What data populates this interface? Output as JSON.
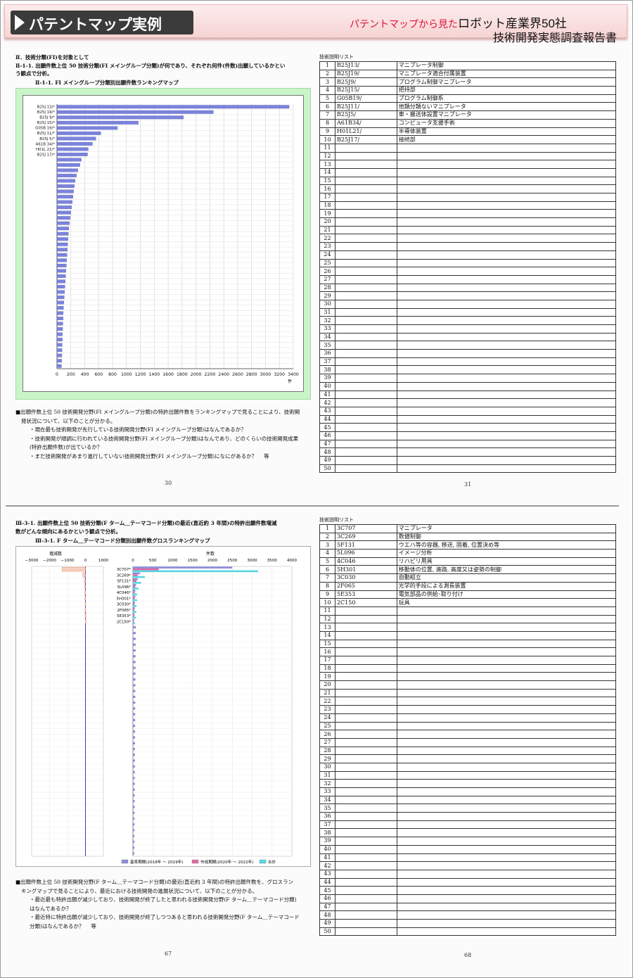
{
  "header": {
    "banner": "パテントマップ実例",
    "sub_red": "パテントマップから見た",
    "sub_main": "ロボット産業界50社",
    "line2": "技術開発実態調査報告書"
  },
  "page30": {
    "heading1": "Ⅱ．技術分類(FI)を対象として",
    "heading2": "Ⅱ-1-1. 出願件数上位 50 技術分類(FI メイングループ分類)が何であり、それぞれ何件(件数)出願しているかとい",
    "heading3": "う観点で分析。",
    "chart_title": "Ⅱ-1-1. FI メイングループ分類別出願件数ランキングマップ",
    "notes": [
      "■出願件数上位 50 技術開発分野(FI メイングループ分類)の特許出願件数をランキングマップで見ることにより、技術開",
      "発状況について、以下のことが分かる。",
      "・現在最も技術開発が先行している技術開発分野(FI メイングループ分類)はなんであるか？",
      "・技術開発が順調に行われている技術開発分野(FI メイングループ分類)はなんであり、どのくらいの技術開発成果",
      "(特許出願件数)が出ているか？",
      "・まだ技術開発があまり進行していない技術開発分野(FI メイングループ分類)になにがあるか？　 等"
    ],
    "page_number": "30"
  },
  "page31": {
    "list_title": "技術説明リスト",
    "rows": [
      {
        "n": "1",
        "code": "B25J13/",
        "desc": "マニプレータ制御"
      },
      {
        "n": "2",
        "code": "B25J19/",
        "desc": "マニプレータ適合付属装置"
      },
      {
        "n": "3",
        "code": "B25J9/",
        "desc": "プログラム制御マニプレータ"
      },
      {
        "n": "4",
        "code": "B25J15/",
        "desc": "把持部"
      },
      {
        "n": "5",
        "code": "G05B19/",
        "desc": "プログラム制御系"
      },
      {
        "n": "6",
        "code": "B25J11/",
        "desc": "他類分類ないマニプレータ"
      },
      {
        "n": "7",
        "code": "B25J5/",
        "desc": "車・搬送体設置マニプレータ"
      },
      {
        "n": "8",
        "code": "A61B34/",
        "desc": "コンピュータ支援手術"
      },
      {
        "n": "9",
        "code": "H01L21/",
        "desc": "半導体装置"
      },
      {
        "n": "10",
        "code": "B25J17/",
        "desc": "接続部"
      }
    ],
    "page_number": "31"
  },
  "page67": {
    "heading1": "Ⅲ-3-1. 出願件数上位 50 技術分類(F ターム＿テーマコード分類)の最近(直近約 3 年間)の特許出願件数増減",
    "heading2": "数がどんな傾向にあるかという観点で分析。",
    "chart_title": "Ⅲ-3-1. F ターム＿テーマコード分類別出願件数グロスランキングマップ",
    "left_axis_label": "増減数",
    "right_axis_label": "件数",
    "legend": [
      "基準期間(2018年 ～ 2019年)",
      "作成期間(2020年 ～ 2022年)",
      "合計"
    ],
    "notes": [
      "■出願件数上位 50 技術開発分野(F ターム＿テーマコード分類)の最近(直近約 3 年間)の特許出願件数を、グロスラン",
      "キングマップで見ることにより、最近における技術開発の進展状況について、以下のことが分かる。",
      "・最近最も特許出願が減少しており、技術開発が終了したと思われる技術開発分野(F ターム＿テーマコード分類)",
      "はなんであるか？",
      "・最近特に特許出願が減少しており、技術開発が終了しつつあると思われる技術開発分野(F ターム＿テーマコード",
      "分類)はなんであるか？　 等"
    ],
    "page_number": "67"
  },
  "page68": {
    "list_title": "技術説明リスト",
    "rows": [
      {
        "n": "1",
        "code": "3C707",
        "desc": "マニプレータ"
      },
      {
        "n": "2",
        "code": "3C269",
        "desc": "数値制御"
      },
      {
        "n": "3",
        "code": "5F131",
        "desc": "ウエハ等の容器, 移送, 固着, 位置決め等"
      },
      {
        "n": "4",
        "code": "5L096",
        "desc": "イメージ分析"
      },
      {
        "n": "5",
        "code": "4C046",
        "desc": "リハビリ用具"
      },
      {
        "n": "6",
        "code": "5H301",
        "desc": "移動体の位置, 進路, 高度又は姿勢の制御"
      },
      {
        "n": "7",
        "code": "3C030",
        "desc": "自動組立"
      },
      {
        "n": "8",
        "code": "2F065",
        "desc": "光学的手段による測長装置"
      },
      {
        "n": "9",
        "code": "5E353",
        "desc": "電気部品の供給･取り付け"
      },
      {
        "n": "10",
        "code": "2C150",
        "desc": "玩具"
      }
    ],
    "page_number": "68"
  },
  "chart_data": [
    {
      "type": "bar",
      "orientation": "horizontal",
      "title": "Ⅱ-1-1. FI メイングループ分類別出願件数ランキングマップ",
      "xlabel": "件",
      "xlim": [
        0,
        3400
      ],
      "xticks": [
        "0",
        "200",
        "400",
        "600",
        "800",
        "1000",
        "1200",
        "1400",
        "1600",
        "1800",
        "2000",
        "2200",
        "2400",
        "2600",
        "2800",
        "3000",
        "3200",
        "3400"
      ],
      "categories": [
        "B25J 13/*",
        "B25J 19/*",
        "B25J 9/*",
        "B25J 15/*",
        "G05B 19/*",
        "B25J 11/*",
        "B25J 5/*",
        "A61B 34/*",
        "H01L 21/*",
        "B25J 17/*"
      ],
      "values": [
        3340,
        2250,
        1820,
        1170,
        870,
        630,
        560,
        510,
        450,
        440,
        350,
        330,
        300,
        280,
        260,
        250,
        240,
        230,
        220,
        210,
        200,
        190,
        180,
        170,
        165,
        160,
        155,
        150,
        145,
        140,
        135,
        130,
        125,
        120,
        115,
        110,
        105,
        100,
        95,
        90,
        88,
        85,
        82,
        80,
        78,
        75,
        72,
        70,
        68,
        65
      ],
      "color": "#7b83de"
    },
    {
      "type": "bar",
      "orientation": "horizontal",
      "title": "Ⅲ-3-1. F ターム＿テーマコード分類別出願件数グロスランキングマップ",
      "left": {
        "label": "増減数",
        "xlim": [
          -3000,
          1000
        ],
        "xticks": [
          "−3000",
          "−2000",
          "−1000",
          "0",
          "1000"
        ]
      },
      "right": {
        "label": "件数",
        "xlim": [
          0,
          4000
        ],
        "xticks": [
          "0",
          "500",
          "1000",
          "1500",
          "2000",
          "2500",
          "3000",
          "3500",
          "4000"
        ]
      },
      "categories": [
        "3C707*",
        "3C269*",
        "5F131*",
        "5L096*",
        "4C046*",
        "5H301*",
        "3C030*",
        "2F065*",
        "5E353*",
        "2C150*"
      ],
      "series": [
        {
          "name": "基準期間(2018年 ～ 2019年)",
          "color": "#8c8cdc",
          "values": [
            2500,
            180,
            120,
            80,
            60,
            60,
            50,
            50,
            40,
            30
          ]
        },
        {
          "name": "作成期間(2020年 ～ 2022年)",
          "color": "#e26aa0",
          "values": [
            650,
            120,
            90,
            60,
            45,
            45,
            40,
            35,
            35,
            25
          ]
        },
        {
          "name": "合計",
          "color": "#56d8e4",
          "values": [
            3150,
            300,
            210,
            140,
            105,
            105,
            90,
            85,
            75,
            55
          ]
        }
      ],
      "change": [
        -1300,
        -150,
        -60,
        -40,
        -30,
        -30,
        -20,
        -20,
        -15,
        -10
      ]
    }
  ]
}
